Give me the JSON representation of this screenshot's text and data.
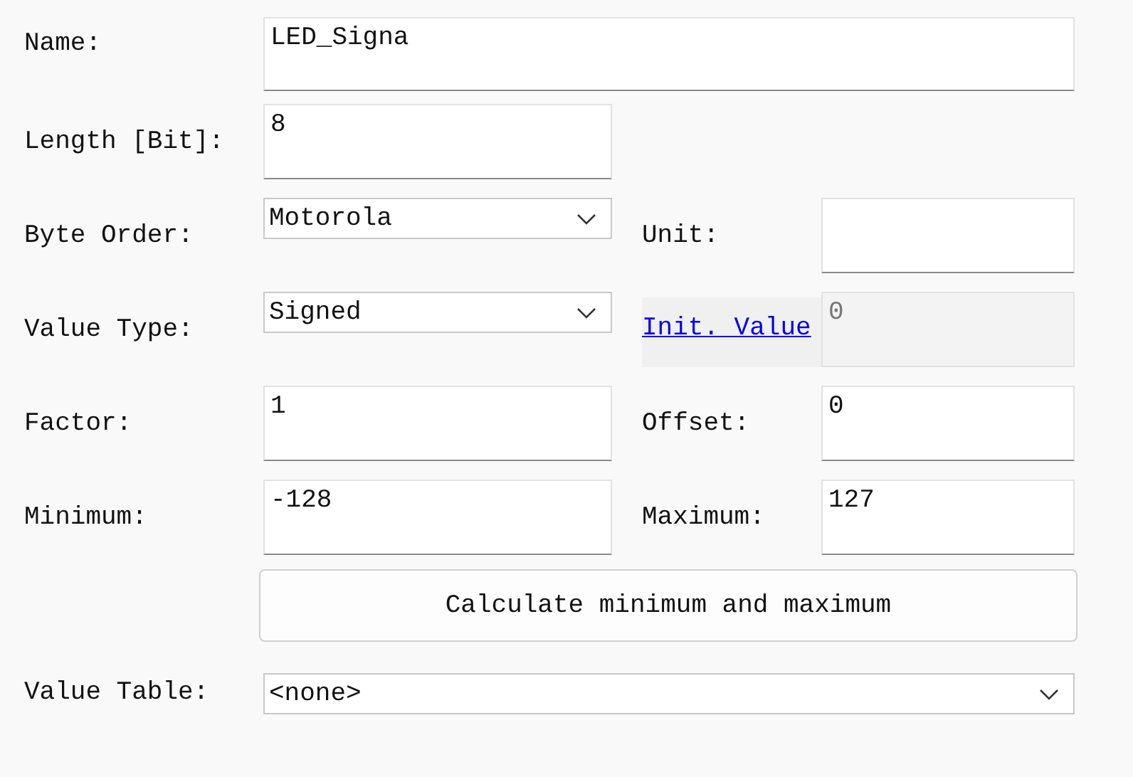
{
  "name": {
    "label": "Name:",
    "value": "LED_Signa"
  },
  "length": {
    "label": "Length [Bit]:",
    "value": "8"
  },
  "byte_order": {
    "label": "Byte Order:",
    "value": "Motorola"
  },
  "unit": {
    "label": "Unit:"
  },
  "value_type": {
    "label": "Value Type:",
    "value": "Signed"
  },
  "init_value": {
    "label": "Init. Value",
    "value": "0",
    "disabled": true
  },
  "factor": {
    "label": "Factor:",
    "value": "1"
  },
  "offset": {
    "label": "Offset:",
    "value": "0"
  },
  "minimum": {
    "label": "Minimum:",
    "value": "-128"
  },
  "maximum": {
    "label": "Maximum:",
    "value": "127"
  },
  "calculate_button": "Calculate minimum and maximum",
  "value_table": {
    "label": "Value Table:",
    "value": "<none>"
  }
}
